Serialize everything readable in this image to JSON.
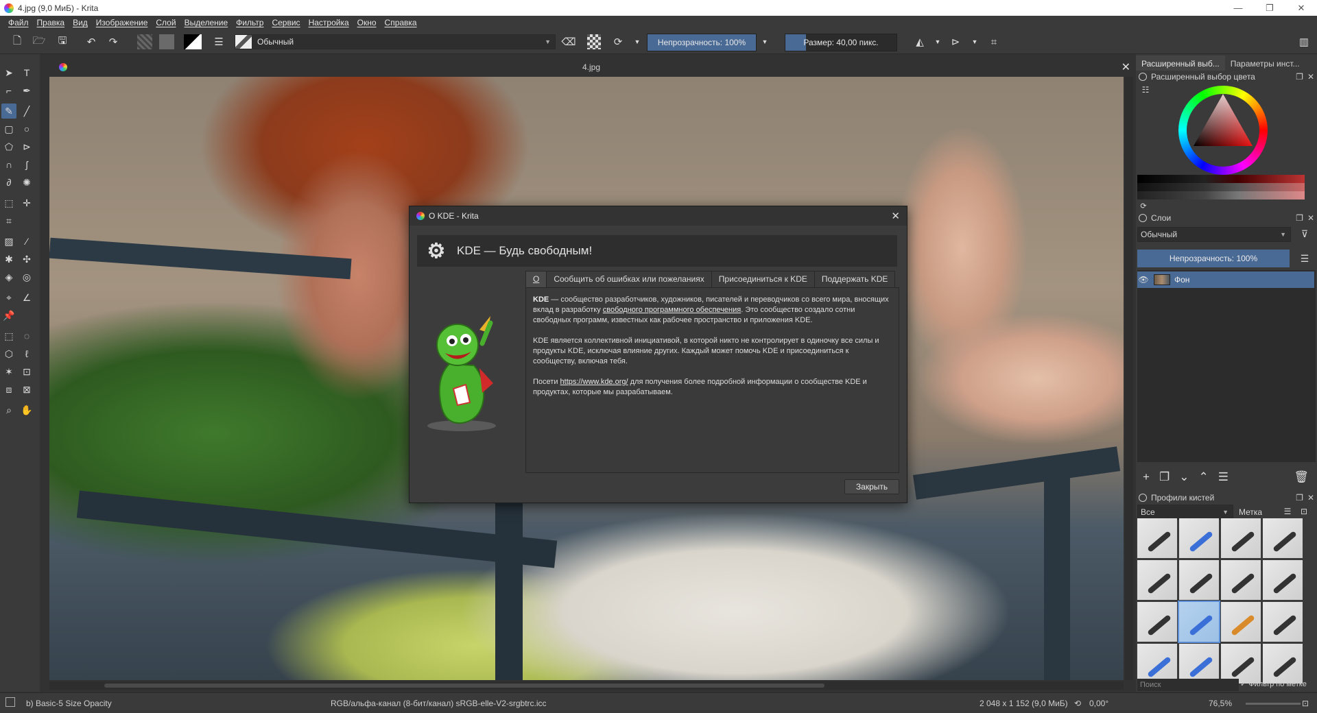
{
  "window": {
    "title": "4.jpg (9,0 МиБ)  - Krita",
    "controls": [
      "—",
      "❐",
      "✕"
    ]
  },
  "menu": [
    "Файл",
    "Правка",
    "Вид",
    "Изображение",
    "Слой",
    "Выделение",
    "Фильтр",
    "Сервис",
    "Настройка",
    "Окно",
    "Справка"
  ],
  "toolbar": {
    "blend_mode": "Обычный",
    "opacity_label": "Непрозрачность: 100%",
    "opacity_value": 1.0,
    "size_label": "Размер: 40,00 пикс.",
    "size_value": 40
  },
  "document": {
    "tab_name": "4.jpg"
  },
  "right_panel": {
    "tabs": [
      "Расширенный выб...",
      "Параметры инст..."
    ],
    "color_dock_title": "Расширенный выбор цвета",
    "layers_title": "Слои",
    "layers_blend": "Обычный",
    "layers_opacity": "Непрозрачность:  100%",
    "layer_name": "Фон",
    "presets_title": "Профили кистей",
    "presets_filter": "Все",
    "presets_tag": "Метка",
    "search_placeholder": "Поиск",
    "filter_by_tag": "Фильтр по метке"
  },
  "status": {
    "preset": "b) Basic-5 Size Opacity",
    "color_info": "RGB/альфа-канал (8-бит/канал)  sRGB-elle-V2-srgbtrc.icc",
    "image_size": "2 048 x 1 152 (9,0 МиБ)",
    "rotation": "0,00°",
    "zoom": "76,5%"
  },
  "dialog": {
    "title": "О KDE - Krita",
    "header": "KDE — Будь свободным!",
    "tabs": [
      "О",
      "Сообщить об ошибках или пожеланиях",
      "Присоединиться к KDE",
      "Поддержать KDE"
    ],
    "p1_bold": "KDE",
    "p1_a": " — сообщество разработчиков, художников, писателей и переводчиков со всего мира, вносящих вклад в разработку ",
    "p1_link": "свободного программного обеспечения",
    "p1_b": ". Это сообщество создало сотни свободных программ, известных как рабочее пространство и приложения KDE.",
    "p2": "KDE является коллективной инициативой, в которой никто не контролирует в одиночку все силы и продукты KDE, исключая влияние других. Каждый может помочь KDE и присоединиться к сообществу, включая тебя.",
    "p3_a": "Посети ",
    "p3_link": "https://www.kde.org/",
    "p3_b": " для получения более подробной информации о сообществе KDE и продуктах, которые мы разрабатываем.",
    "close_button": "Закрыть"
  },
  "colors": {
    "accent": "#4a6a96",
    "panel_bg": "#3a3a3a",
    "dark_bg": "#2e2e2e"
  }
}
